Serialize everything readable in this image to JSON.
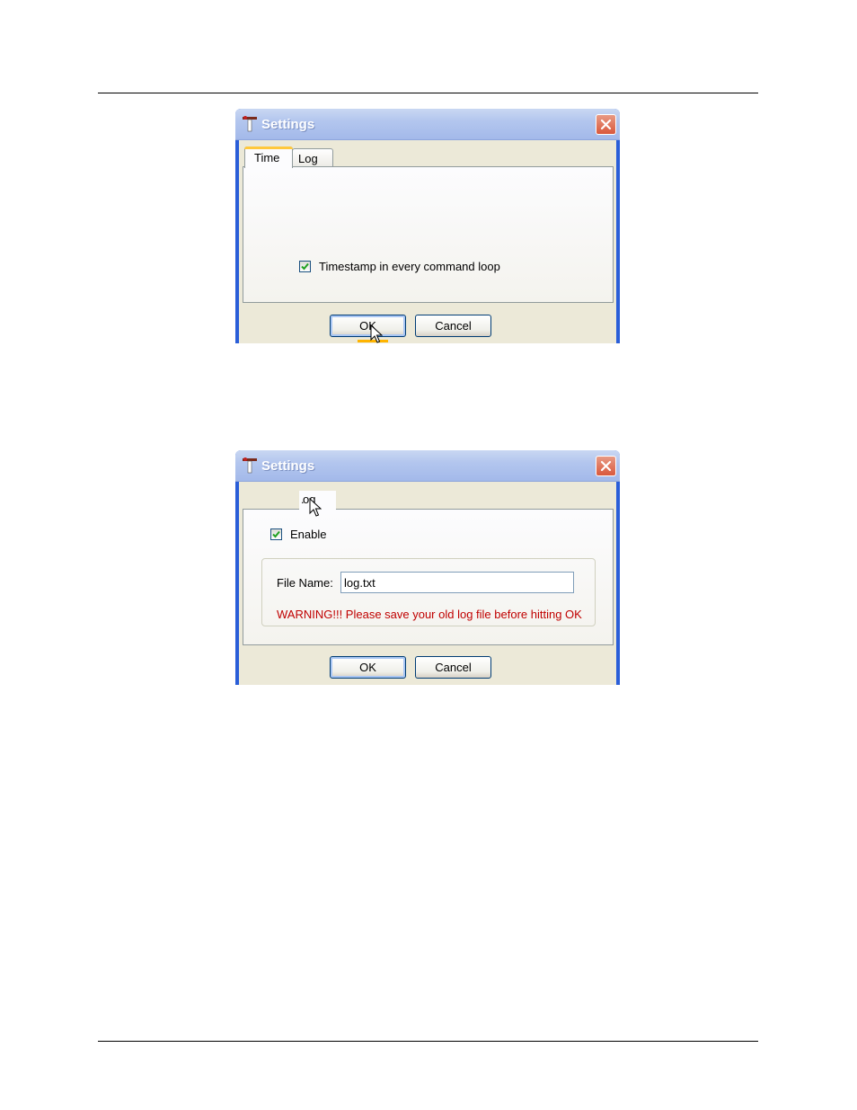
{
  "dialog_time": {
    "title": "Settings",
    "tabs": [
      {
        "label": "Time",
        "active": true
      },
      {
        "label": "Log",
        "active": false
      }
    ],
    "checkbox": {
      "label": "Timestamp in every command loop",
      "checked": true
    },
    "buttons": {
      "ok": "OK",
      "cancel": "Cancel"
    }
  },
  "dialog_log": {
    "title": "Settings",
    "tab_label": "og",
    "tab_partial_prefix": ".",
    "enable": {
      "label": "Enable",
      "checked": true
    },
    "file_name_label": "File Name:",
    "file_name_value": "log.txt",
    "warning": "WARNING!!! Please save your old log file before hitting OK",
    "buttons": {
      "ok": "OK",
      "cancel": "Cancel"
    }
  },
  "colors": {
    "title_text": "#ffffff",
    "close_button": "#d9583c",
    "warning_text": "#c00000",
    "checkmark": "#21a121",
    "tab_highlight": "#ffc83c"
  },
  "icons": [
    "app-icon",
    "close-icon",
    "checkmark-icon",
    "mouse-cursor-icon"
  ]
}
